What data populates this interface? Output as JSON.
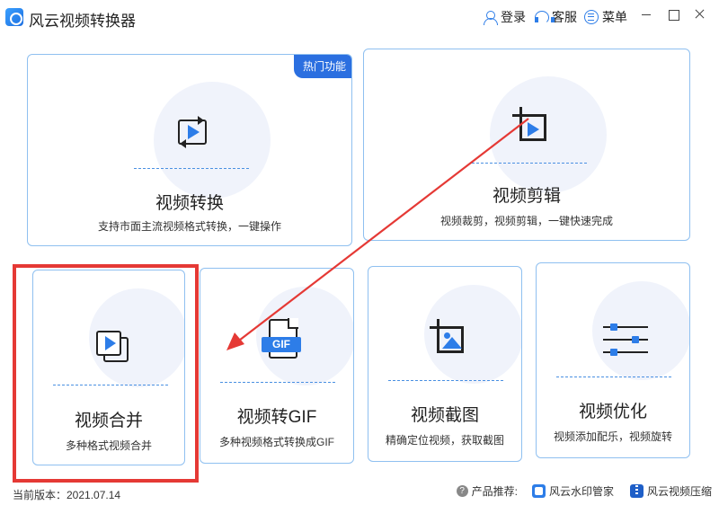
{
  "app": {
    "title": "风云视频转换器",
    "login_label": "登录",
    "service_label": "客服",
    "menu_label": "菜单"
  },
  "cards": {
    "convert": {
      "title": "视频转换",
      "desc": "支持市面主流视频格式转换，一键操作",
      "badge": "热门功能"
    },
    "edit": {
      "title": "视频剪辑",
      "desc": "视频裁剪，视频剪辑，一键快速完成"
    },
    "merge": {
      "title": "视频合并",
      "desc": "多种格式视频合并"
    },
    "gif": {
      "title": "视频转GIF",
      "desc": "多种视频格式转换成GIF",
      "icon_text": "GIF"
    },
    "screenshot": {
      "title": "视频截图",
      "desc": "精确定位视频，获取截图"
    },
    "optimize": {
      "title": "视频优化",
      "desc": "视频添加配乐，视频旋转"
    }
  },
  "footer": {
    "version": "当前版本：2021.07.14",
    "recommend_label": "产品推荐:",
    "product1": "风云水印管家",
    "product2": "风云视频压缩"
  },
  "icons": {
    "accent": "#2d7de8",
    "highlight": "#e53935",
    "card_border": "#8fc0f0"
  }
}
